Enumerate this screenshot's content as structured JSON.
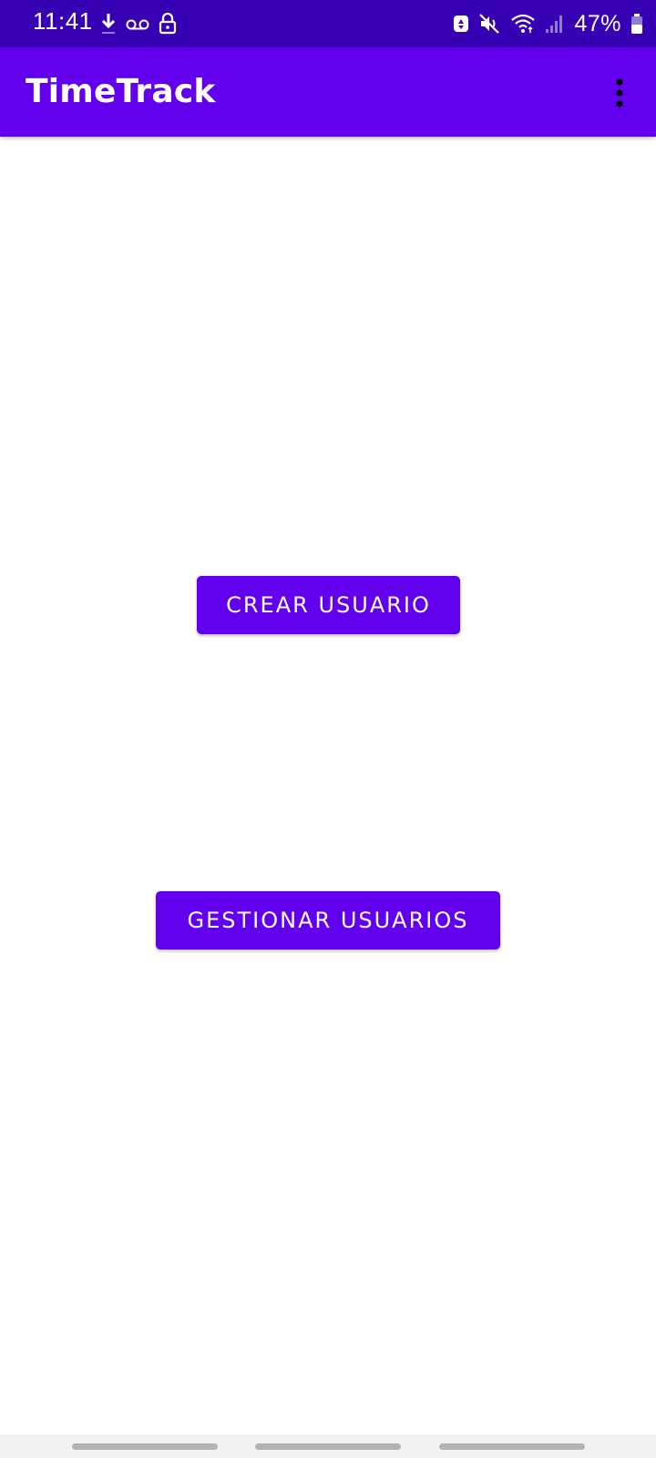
{
  "status_bar": {
    "time": "11:41",
    "left_icons": [
      "download-icon",
      "voicemail-icon",
      "lock-icon"
    ],
    "right_icons": [
      "battery-saver-icon",
      "mute-icon",
      "wifi-icon",
      "signal-icon",
      "battery-icon"
    ],
    "battery_percent": "47%",
    "background_color": "#3700b3"
  },
  "app_bar": {
    "title": "TimeTrack",
    "menu_icon": "more-vert-icon",
    "background_color": "#6200ee"
  },
  "main": {
    "create_user_button": "CREAR USUARIO",
    "manage_users_button": "GESTIONAR USUARIOS",
    "button_color": "#6200ee"
  },
  "nav_bar": {
    "items": [
      "recent-apps-handle",
      "home-handle",
      "back-handle"
    ]
  }
}
